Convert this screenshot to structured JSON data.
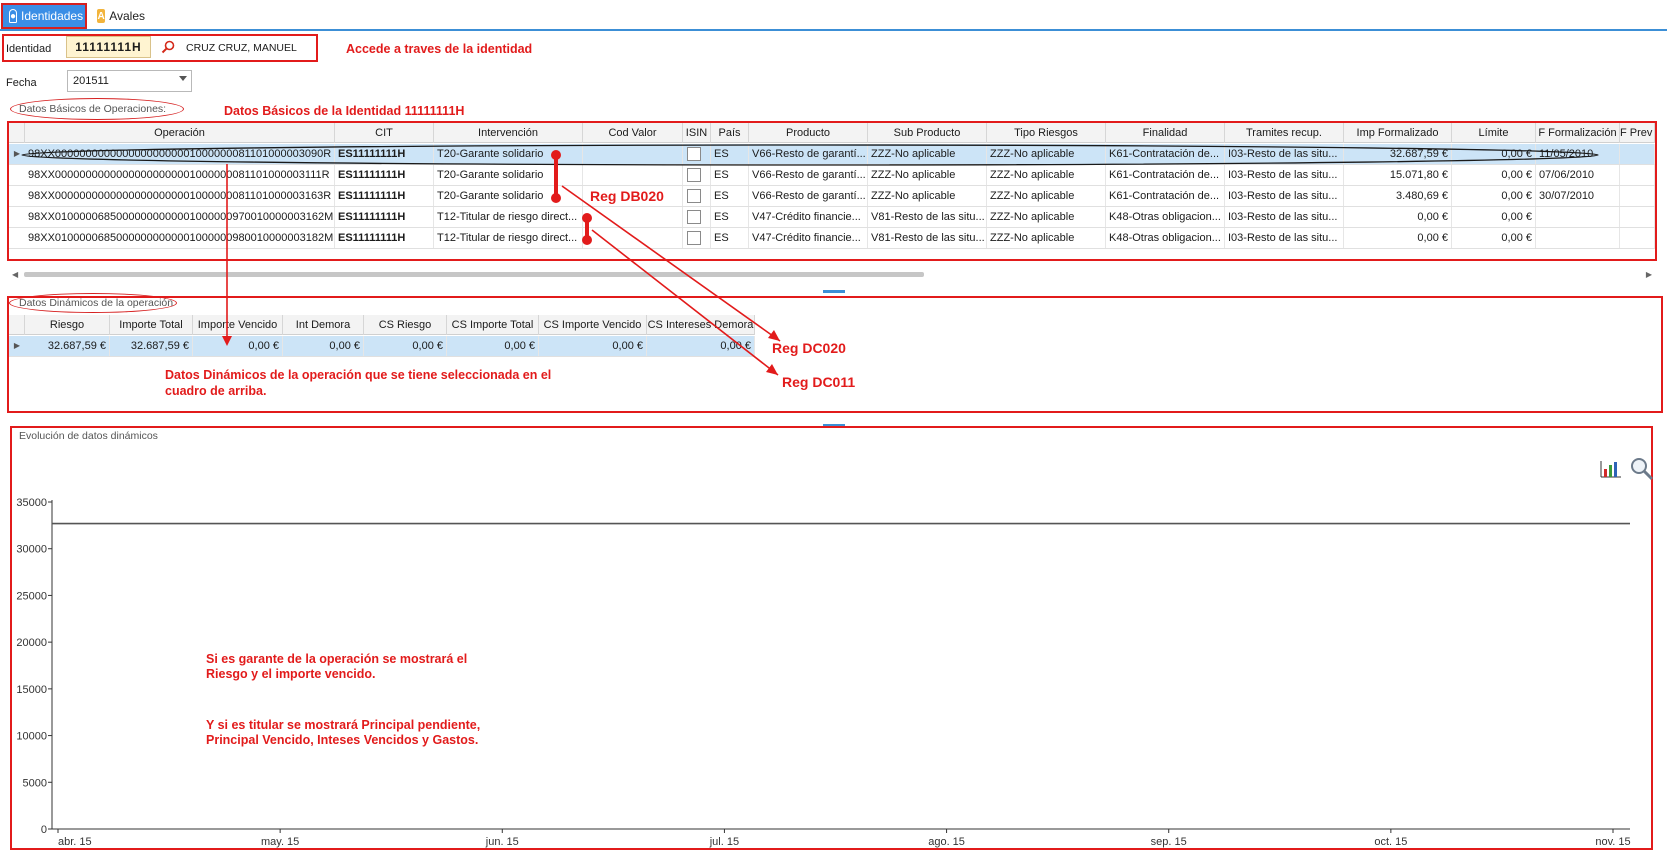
{
  "tabs": [
    {
      "label": "Identidades",
      "icon": "user-icon"
    },
    {
      "label": "Avales",
      "icon": "aval-icon"
    }
  ],
  "identity": {
    "label": "Identidad",
    "value": "11111111H",
    "name": "CRUZ  CRUZ, MANUEL",
    "annotation": "Accede a traves de la identidad"
  },
  "fecha": {
    "label": "Fecha",
    "value": "201511"
  },
  "basic_panel": {
    "title": "Datos Básicos de Operaciones:",
    "annotation": "Datos Básicos de la Identidad 11111111H",
    "columns": [
      "Operación",
      "CIT",
      "Intervención",
      "Cod Valor",
      "ISIN",
      "País",
      "Producto",
      "Sub Producto",
      "Tipo Riesgos",
      "Finalidad",
      "Tramites recup.",
      "Imp Formalizado",
      "Límite",
      "F Formalización",
      "F Prev Can"
    ],
    "rows": [
      [
        "98XX00000000000000000000001000000081101000003090R",
        "ES11111111H",
        "T20-Garante solidario",
        "",
        "",
        "ES",
        "V66-Resto de garantí...",
        "ZZZ-No aplicable",
        "ZZZ-No aplicable",
        "K61-Contratación de...",
        "I03-Resto de las situ...",
        "32.687,59 €",
        "0,00 €",
        "11/05/2010",
        ""
      ],
      [
        "98XX00000000000000000000001000000081101000003111R",
        "ES11111111H",
        "T20-Garante solidario",
        "",
        "",
        "ES",
        "V66-Resto de garantí...",
        "ZZZ-No aplicable",
        "ZZZ-No aplicable",
        "K61-Contratación de...",
        "I03-Resto de las situ...",
        "15.071,80 €",
        "0,00 €",
        "07/06/2010",
        ""
      ],
      [
        "98XX00000000000000000000001000000081101000003163R",
        "ES11111111H",
        "T20-Garante solidario",
        "",
        "",
        "ES",
        "V66-Resto de garantí...",
        "ZZZ-No aplicable",
        "ZZZ-No aplicable",
        "K61-Contratación de...",
        "I03-Resto de las situ...",
        "3.480,69 €",
        "0,00 €",
        "30/07/2010",
        ""
      ],
      [
        "98XX01000006850000000000001000000970010000003162M",
        "ES11111111H",
        "T12-Titular de riesgo direct...",
        "",
        "",
        "ES",
        "V47-Crédito financie...",
        "V81-Resto de las situ...",
        "ZZZ-No aplicable",
        "K48-Otras obligacion...",
        "I03-Resto de las situ...",
        "0,00 €",
        "0,00 €",
        "",
        ""
      ],
      [
        "98XX01000006850000000000001000000980010000003182M",
        "ES11111111H",
        "T12-Titular de riesgo direct...",
        "",
        "",
        "ES",
        "V47-Crédito financie...",
        "V81-Resto de las situ...",
        "ZZZ-No aplicable",
        "K48-Otras obligacion...",
        "I03-Resto de las situ...",
        "0,00 €",
        "0,00 €",
        "",
        ""
      ]
    ],
    "reg_label": "Reg DB020"
  },
  "dynamic_panel": {
    "title": "Datos Dinámicos de la operación",
    "columns": [
      "Riesgo",
      "Importe Total",
      "Importe Vencido",
      "Int Demora",
      "CS Riesgo",
      "CS Importe Total",
      "CS Importe Vencido",
      "CS Intereses Demora"
    ],
    "row": [
      "32.687,59 €",
      "32.687,59 €",
      "0,00 €",
      "0,00 €",
      "0,00 €",
      "0,00 €",
      "0,00 €",
      "0,00 €"
    ],
    "annotation_line1": "Datos Dinámicos de la operación que se tiene seleccionada en el",
    "annotation_line2": "cuadro de arriba.",
    "reg_dc020": "Reg DC020",
    "reg_dc011": "Reg DC011"
  },
  "evolution_panel": {
    "title": "Evolución de datos dinámicos",
    "note_line1": "Si es garante de la operación se mostrará el",
    "note_line2": "Riesgo y el importe vencido.",
    "note_line3": "Y si es titular se mostrará Principal pendiente,",
    "note_line4": "Principal Vencido, Inteses Vencidos y Gastos."
  },
  "chart_data": {
    "type": "line",
    "title": "",
    "xlabel": "",
    "ylabel": "",
    "ylim": [
      0,
      35000
    ],
    "yticks": [
      0,
      5000,
      10000,
      15000,
      20000,
      25000,
      30000,
      35000
    ],
    "xtick_labels": [
      "abr. 15",
      "may. 15",
      "jun. 15",
      "jul. 15",
      "ago. 15",
      "sep. 15",
      "oct. 15",
      "nov. 15"
    ],
    "series": [
      {
        "values": [
          32687.59,
          32687.59,
          32687.59,
          32687.59,
          32687.59,
          32687.59,
          32687.59,
          32687.59
        ],
        "color": "#555555"
      }
    ],
    "grid": false
  }
}
